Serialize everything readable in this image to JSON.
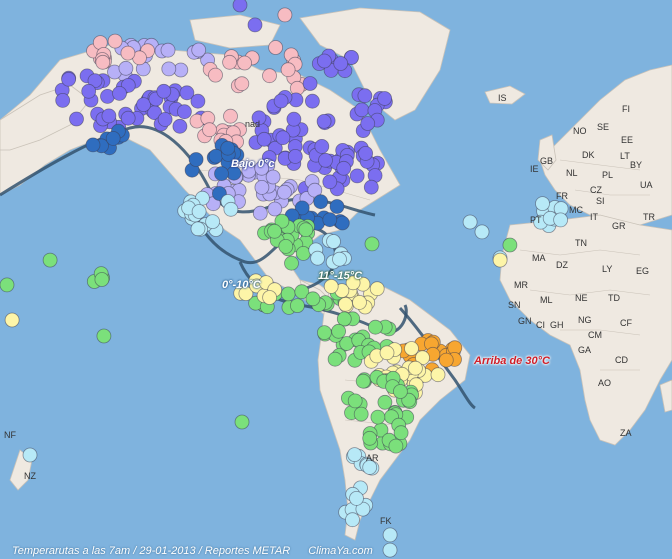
{
  "footer": {
    "caption": "Temperarutas a las 7am / 29-01-2013 / Reportes METAR",
    "brand": "ClimaYa.com"
  },
  "band_labels": {
    "below_zero": "Bajo 0°c",
    "zero_ten": "0°-10°C",
    "eleven_fifteen": "11°-15°C",
    "above_thirty": "Arriba de 30°C"
  },
  "place_labels": [
    "IS",
    "FI",
    "SE",
    "NO",
    "EE",
    "GB",
    "DK",
    "LT",
    "IE",
    "NL",
    "PL",
    "BY",
    "FR",
    "CZ",
    "UA",
    "MC",
    "SI",
    "IT",
    "PT",
    "GR",
    "TR",
    "TN",
    "MA",
    "DZ",
    "LY",
    "EG",
    "MR",
    "ML",
    "NE",
    "SN",
    "TD",
    "GN",
    "CI",
    "GH",
    "NG",
    "CM",
    "CF",
    "GA",
    "CD",
    "AO",
    "ZA",
    "NF",
    "NZ",
    "FK",
    "AR",
    "nad"
  ],
  "colors": {
    "ocean": "#7fb3de",
    "land": "#efe9e1",
    "below_zero": "#7b6ef0",
    "pink": "#f7bcc2",
    "light_violet": "#b7b0f7",
    "blue_dark": "#2f6dbf",
    "light_blue": "#b7e9f7",
    "green": "#7be07b",
    "light_yellow": "#fdf5a8",
    "orange": "#f7a630"
  },
  "station_legend_colors": [
    "#7b6ef0",
    "#f7bcc2",
    "#b7b0f7",
    "#2f6dbf",
    "#b7e9f7",
    "#7be07b",
    "#fdf5a8",
    "#f7a630"
  ]
}
